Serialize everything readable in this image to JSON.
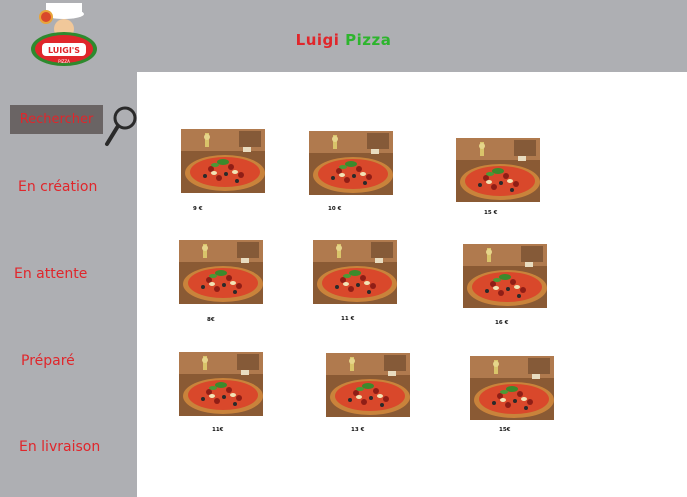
{
  "app": {
    "title_part1": "Luigi",
    "title_part2": "Pizza",
    "logo_text": "LUIGI'S",
    "logo_subtext": "PIZZA"
  },
  "colors": {
    "header_bg": "#aeafb3",
    "accent_red": "#e0262b",
    "accent_green": "#2db52d",
    "search_button_bg": "#6a6464"
  },
  "sidebar": {
    "search_label": "Rechercher",
    "search_icon": "magnifier-icon",
    "items": [
      {
        "label": "En création"
      },
      {
        "label": "En attente"
      },
      {
        "label": "Préparé"
      },
      {
        "label": "En livraison"
      }
    ]
  },
  "pizzas": [
    {
      "price": "9 €"
    },
    {
      "price": "10 €"
    },
    {
      "price": "15 €"
    },
    {
      "price": "8€"
    },
    {
      "price": "11 €"
    },
    {
      "price": "16 €"
    },
    {
      "price": "11€"
    },
    {
      "price": "13 €"
    },
    {
      "price": "15€"
    }
  ]
}
